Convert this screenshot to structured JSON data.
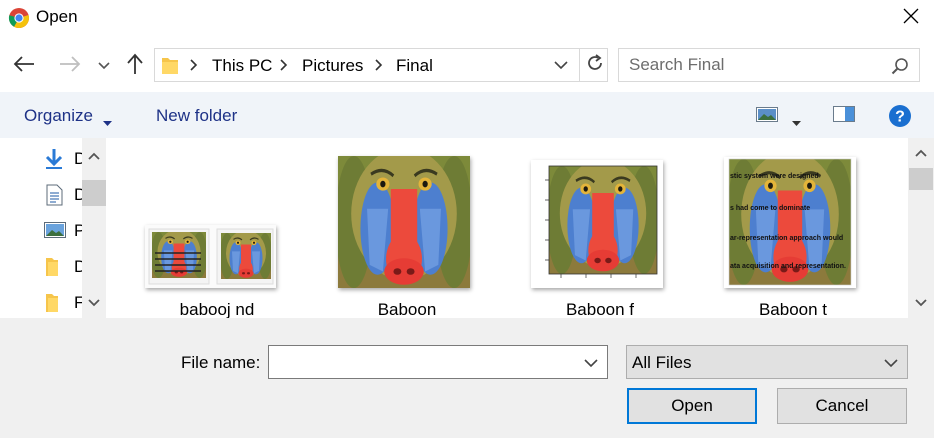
{
  "window": {
    "title": "Open",
    "app_icon": "chrome-icon",
    "close_icon": "close-icon"
  },
  "nav": {
    "back_icon": "back-arrow-icon",
    "forward_icon": "forward-arrow-icon",
    "recent_icon": "chevron-down-icon",
    "up_icon": "up-arrow-icon"
  },
  "address": {
    "crumbs": [
      "This PC",
      "Pictures",
      "Final"
    ],
    "folder_icon": "folder-icon",
    "refresh_icon": "refresh-icon"
  },
  "search": {
    "placeholder": "Search Final",
    "icon": "search-icon"
  },
  "toolbar": {
    "organize_label": "Organize",
    "new_folder_label": "New folder",
    "view_icon": "view-options-icon",
    "preview_icon": "preview-pane-icon",
    "help_icon": "help-icon"
  },
  "sidebar": {
    "items": [
      {
        "label": "D",
        "icon": "downloads-icon"
      },
      {
        "label": "D",
        "icon": "documents-icon"
      },
      {
        "label": "P",
        "icon": "pictures-icon"
      },
      {
        "label": "D",
        "icon": "folder-icon"
      },
      {
        "label": "F",
        "icon": "folder-icon"
      }
    ]
  },
  "files": [
    {
      "name": "babooj nd"
    },
    {
      "name": "Baboon"
    },
    {
      "name": "Baboon f"
    },
    {
      "name": "Baboon t",
      "overlay_lines": [
        "stic system were designed",
        "s had come to dominate",
        "ar-representation approach would",
        "ata acquisition and representation."
      ]
    }
  ],
  "bottom": {
    "file_name_label": "File name:",
    "file_name_value": "",
    "file_type": "All Files",
    "open_label": "Open",
    "cancel_label": "Cancel"
  },
  "colors": {
    "accent": "#0078d7",
    "toolbar_bg": "#f0f4f9",
    "link": "#1e3287",
    "bottom_bg": "#f0f0f0"
  }
}
